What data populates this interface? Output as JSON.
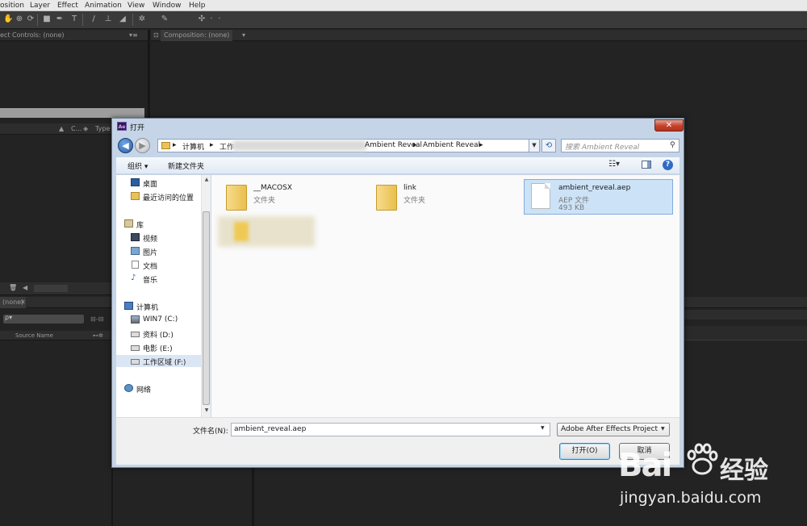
{
  "ae": {
    "menu": [
      "osition",
      "Layer",
      "Effect",
      "Animation",
      "View",
      "Window",
      "Help"
    ],
    "effect_controls_tab": "ect Controls: (none)",
    "composition_tab": "Composition: (none)",
    "project_col_type": "Type",
    "project_col_c": "C...",
    "timeline_tab": "(none)",
    "source_name_col": "Source Name"
  },
  "dialog": {
    "title": "打开",
    "close_glyph": "✕",
    "address": {
      "seg1": "计算机",
      "seg2": "工作",
      "seg3": "Ambient Reveal",
      "seg4": "Ambient Reveal",
      "separator": "▸"
    },
    "search_placeholder": "搜索 Ambient Reveal",
    "toolbar": {
      "organize": "组织 ▾",
      "new_folder": "新建文件夹"
    },
    "nav": {
      "desktop": "桌面",
      "recent": "最近访问的位置",
      "libraries": "库",
      "videos": "视频",
      "pictures": "图片",
      "documents": "文档",
      "music": "音乐",
      "computer": "计算机",
      "drive_c": "WIN7 (C:)",
      "drive_d": "资料 (D:)",
      "drive_e": "电影 (E:)",
      "drive_f": "工作区域 (F:)",
      "network": "网络"
    },
    "files": [
      {
        "name": "__MACOSX",
        "type": "文件夹",
        "size": ""
      },
      {
        "name": "link",
        "type": "文件夹",
        "size": ""
      },
      {
        "name": "ambient_reveal.aep",
        "type": "AEP 文件",
        "size": "493 KB"
      }
    ],
    "filename_label": "文件名(N):",
    "filename_value": "ambient_reveal.aep",
    "filetype_value": "Adobe After Effects Project (",
    "open_button": "打开(O)",
    "cancel_button": "取消"
  },
  "watermark": {
    "brand_latin": "Bai",
    "brand_cn": "经验",
    "url": "jingyan.baidu.com"
  }
}
